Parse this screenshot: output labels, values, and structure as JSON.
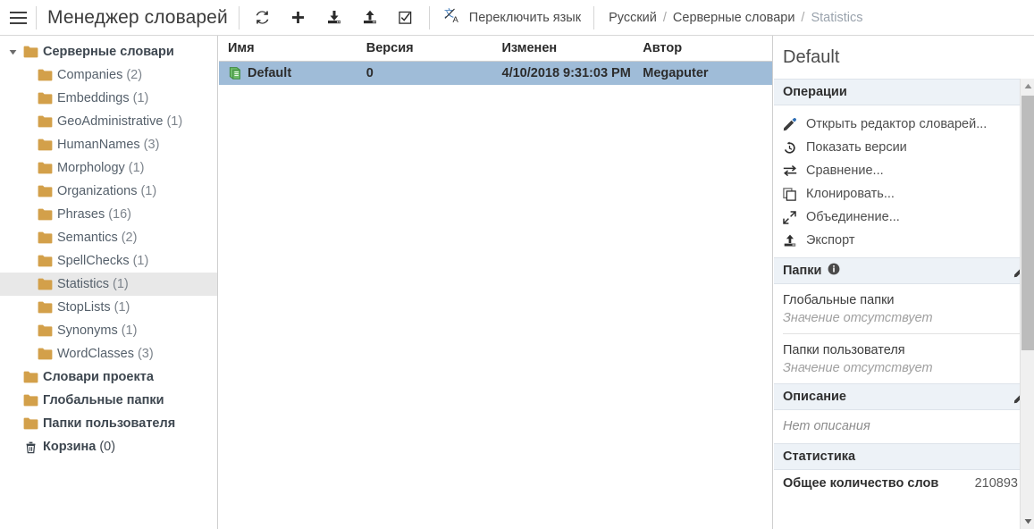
{
  "app": {
    "title": "Менеджер словарей",
    "menu_icon": "hamburger-icon"
  },
  "toolbar": {
    "buttons": [
      {
        "name": "refresh",
        "icon": "refresh-icon",
        "label": ""
      },
      {
        "name": "add",
        "icon": "plus-icon",
        "label": ""
      },
      {
        "name": "import",
        "icon": "import-icon",
        "label": ""
      },
      {
        "name": "export",
        "icon": "export-icon",
        "label": ""
      },
      {
        "name": "select",
        "icon": "checkbox-icon",
        "label": ""
      }
    ],
    "language_switch": {
      "icon": "translate-icon",
      "label": "Переключить язык"
    }
  },
  "breadcrumb": {
    "separator": "/",
    "items": [
      {
        "label": "Русский",
        "current": false
      },
      {
        "label": "Серверные словари",
        "current": false
      },
      {
        "label": "Statistics",
        "current": true
      }
    ]
  },
  "sidebar": {
    "items": [
      {
        "label": "Серверные словари",
        "count": "",
        "depth": 0,
        "bold": true,
        "expanded": true,
        "icon": "folder-icon",
        "selected": false
      },
      {
        "label": "Companies",
        "count": "(2)",
        "depth": 1,
        "bold": false,
        "expanded": null,
        "icon": "folder-icon",
        "selected": false
      },
      {
        "label": "Embeddings",
        "count": "(1)",
        "depth": 1,
        "bold": false,
        "expanded": null,
        "icon": "folder-icon",
        "selected": false
      },
      {
        "label": "GeoAdministrative",
        "count": "(1)",
        "depth": 1,
        "bold": false,
        "expanded": null,
        "icon": "folder-icon",
        "selected": false
      },
      {
        "label": "HumanNames",
        "count": "(3)",
        "depth": 1,
        "bold": false,
        "expanded": null,
        "icon": "folder-icon",
        "selected": false
      },
      {
        "label": "Morphology",
        "count": "(1)",
        "depth": 1,
        "bold": false,
        "expanded": null,
        "icon": "folder-icon",
        "selected": false
      },
      {
        "label": "Organizations",
        "count": "(1)",
        "depth": 1,
        "bold": false,
        "expanded": null,
        "icon": "folder-icon",
        "selected": false
      },
      {
        "label": "Phrases",
        "count": "(16)",
        "depth": 1,
        "bold": false,
        "expanded": null,
        "icon": "folder-icon",
        "selected": false
      },
      {
        "label": "Semantics",
        "count": "(2)",
        "depth": 1,
        "bold": false,
        "expanded": null,
        "icon": "folder-icon",
        "selected": false
      },
      {
        "label": "SpellChecks",
        "count": "(1)",
        "depth": 1,
        "bold": false,
        "expanded": null,
        "icon": "folder-icon",
        "selected": false
      },
      {
        "label": "Statistics",
        "count": "(1)",
        "depth": 1,
        "bold": false,
        "expanded": null,
        "icon": "folder-icon",
        "selected": true
      },
      {
        "label": "StopLists",
        "count": "(1)",
        "depth": 1,
        "bold": false,
        "expanded": null,
        "icon": "folder-icon",
        "selected": false
      },
      {
        "label": "Synonyms",
        "count": "(1)",
        "depth": 1,
        "bold": false,
        "expanded": null,
        "icon": "folder-icon",
        "selected": false
      },
      {
        "label": "WordClasses",
        "count": "(3)",
        "depth": 1,
        "bold": false,
        "expanded": null,
        "icon": "folder-icon",
        "selected": false
      },
      {
        "label": "Словари проекта",
        "count": "",
        "depth": 0,
        "bold": true,
        "expanded": null,
        "icon": "folder-icon",
        "selected": false
      },
      {
        "label": "Глобальные папки",
        "count": "",
        "depth": 0,
        "bold": true,
        "expanded": null,
        "icon": "folder-icon",
        "selected": false
      },
      {
        "label": "Папки пользователя",
        "count": "",
        "depth": 0,
        "bold": true,
        "expanded": null,
        "icon": "folder-icon",
        "selected": false
      },
      {
        "label": "Корзина",
        "count": "(0)",
        "depth": 0,
        "bold": true,
        "expanded": null,
        "icon": "trash-icon",
        "selected": false
      }
    ]
  },
  "table": {
    "columns": [
      {
        "key": "name",
        "label": "Имя"
      },
      {
        "key": "version",
        "label": "Версия"
      },
      {
        "key": "modified",
        "label": "Изменен"
      },
      {
        "key": "author",
        "label": "Автор"
      }
    ],
    "rows": [
      {
        "icon": "book-icon",
        "name": "Default",
        "version": "0",
        "modified": "4/10/2018 9:31:03 PM",
        "author": "Megaputer",
        "selected": true
      }
    ]
  },
  "details": {
    "title": "Default",
    "operations": {
      "heading": "Операции",
      "items": [
        {
          "icon": "pencil-icon",
          "label": "Открыть редактор словарей..."
        },
        {
          "icon": "history-icon",
          "label": "Показать версии"
        },
        {
          "icon": "compare-icon",
          "label": "Сравнение..."
        },
        {
          "icon": "clone-icon",
          "label": "Клонировать..."
        },
        {
          "icon": "merge-icon",
          "label": "Объединение..."
        },
        {
          "icon": "export-icon",
          "label": "Экспорт"
        }
      ]
    },
    "folders": {
      "heading": "Папки",
      "info_icon": "info-icon",
      "edit_icon": "pencil-icon",
      "fields": [
        {
          "label": "Глобальные папки",
          "value": "Значение отсутствует"
        },
        {
          "label": "Папки пользователя",
          "value": "Значение отсутствует"
        }
      ]
    },
    "description": {
      "heading": "Описание",
      "edit_icon": "pencil-icon",
      "value": "Нет описания"
    },
    "statistics": {
      "heading": "Статистика",
      "rows": [
        {
          "label": "Общее количество слов",
          "value": "210893"
        }
      ]
    }
  },
  "scrollbar": {
    "up_icon": "caret-up-icon",
    "down_icon": "caret-down-icon"
  },
  "colors": {
    "row_selected": "#9fbcd8",
    "tree_selected": "#e8e8e8",
    "section_header": "#edf2f7",
    "folder": "#d3a04a",
    "book": "#6fbd6a",
    "text": "#4a4a4a"
  }
}
